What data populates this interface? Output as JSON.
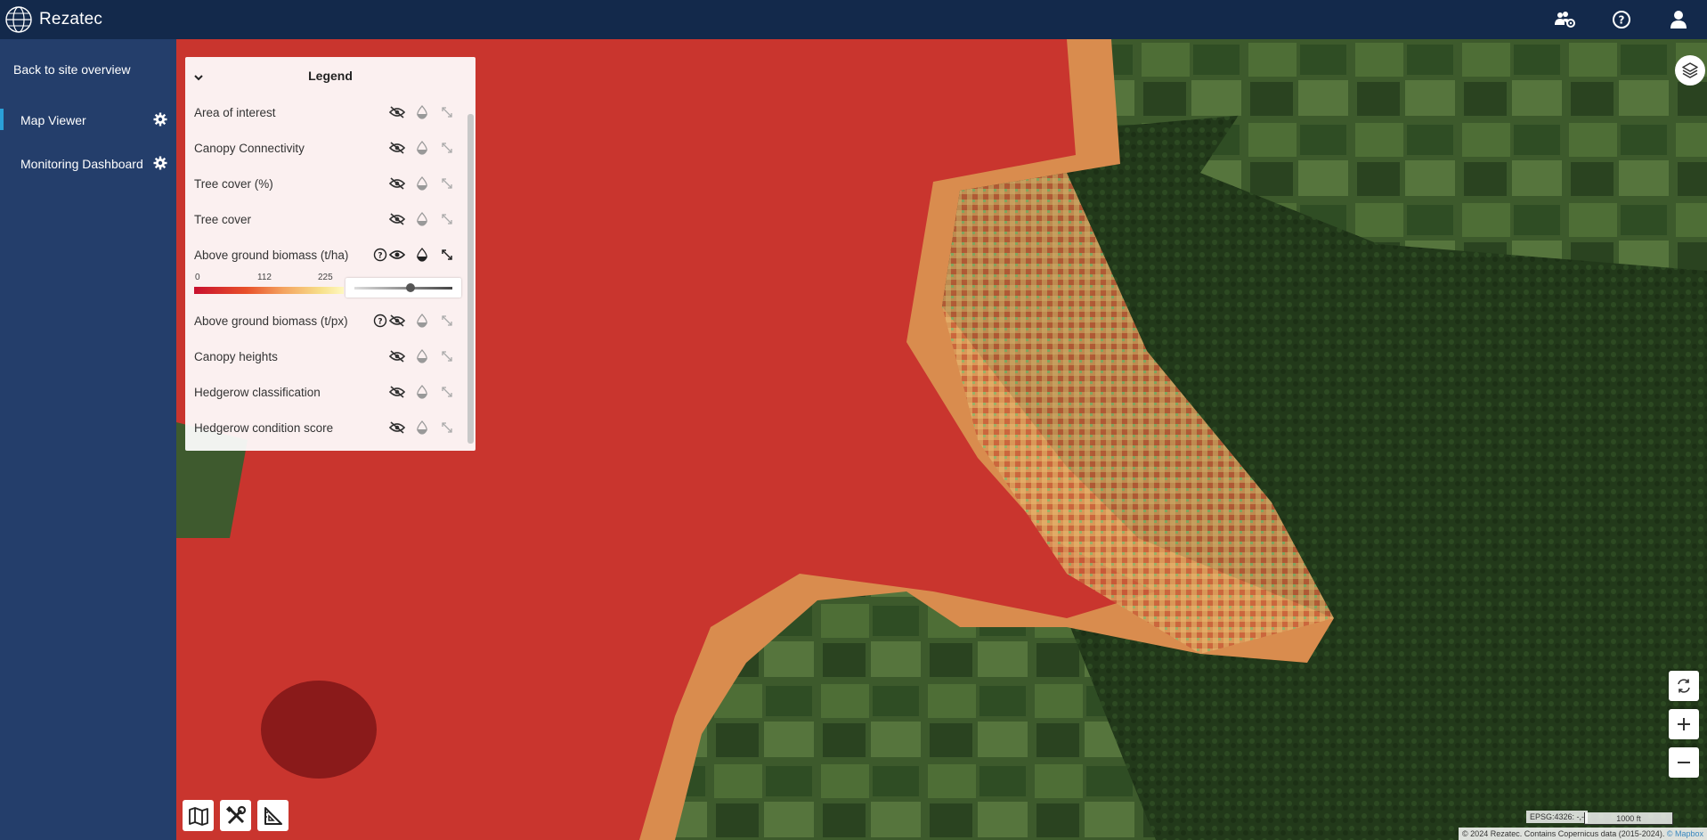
{
  "app": {
    "name": "Rezatec"
  },
  "top_icons": [
    "group-settings-icon",
    "help-icon",
    "user-icon"
  ],
  "sidebar": {
    "back_label": "Back to site overview",
    "items": [
      {
        "label": "Map Viewer",
        "active": true
      },
      {
        "label": "Monitoring Dashboard",
        "active": false
      }
    ]
  },
  "legend": {
    "title": "Legend",
    "layers": [
      {
        "label": "Area of interest"
      },
      {
        "label": "Canopy Connectivity"
      },
      {
        "label": "Tree cover (%)"
      },
      {
        "label": "Tree cover"
      },
      {
        "label": "Above ground biomass (t/ha)",
        "visible": true,
        "has_info": true
      },
      {
        "label": "Above ground biomass (t/px)",
        "has_info": true
      },
      {
        "label": "Canopy heights"
      },
      {
        "label": "Hedgerow classification"
      },
      {
        "label": "Hedgerow condition score"
      }
    ],
    "biomass_scale": {
      "min": "0",
      "mid": "112",
      "max": "225"
    },
    "opacity_value": 0.5
  },
  "map": {
    "epsg": "EPSG:4326: -,-",
    "scale": "1000 ft",
    "attribution": "© 2024 Rezatec. Contains Copernicus data (2015-2024).",
    "attribution_link": "© Mapbox"
  },
  "colors": {
    "topbar": "#13294b",
    "sidebar": "#243e6b",
    "accent": "#2aa0d8"
  }
}
